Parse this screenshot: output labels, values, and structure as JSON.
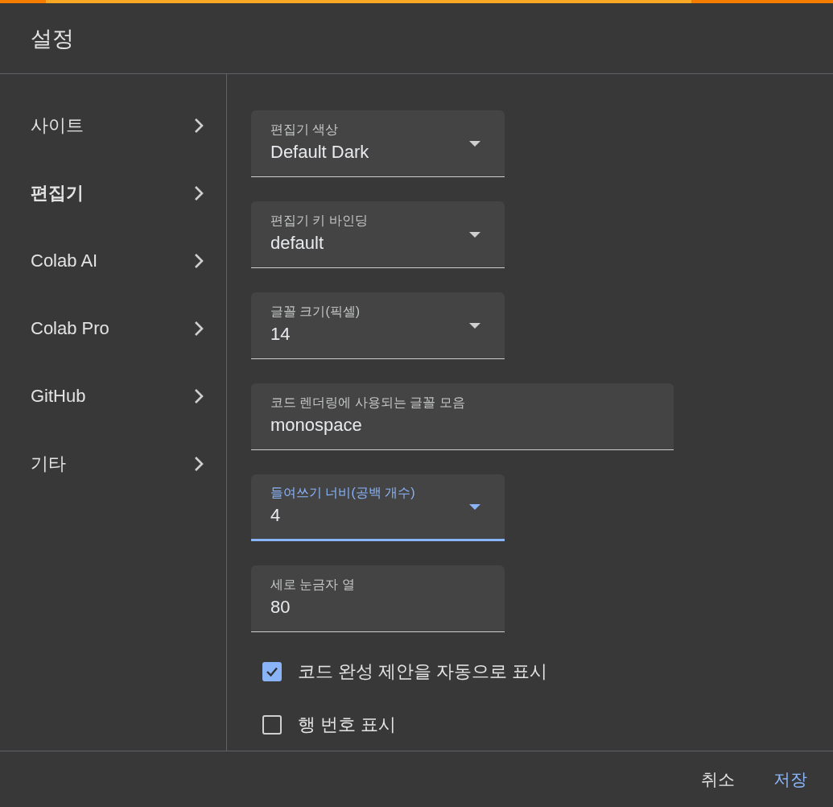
{
  "dialog": {
    "title": "설정"
  },
  "sidebar": {
    "items": [
      {
        "label": "사이트",
        "selected": false
      },
      {
        "label": "편집기",
        "selected": true
      },
      {
        "label": "Colab AI",
        "selected": false
      },
      {
        "label": "Colab Pro",
        "selected": false
      },
      {
        "label": "GitHub",
        "selected": false
      },
      {
        "label": "기타",
        "selected": false
      }
    ]
  },
  "settings": [
    {
      "kind": "select",
      "label": "편집기 색상",
      "value": "Default Dark",
      "focused": false
    },
    {
      "kind": "select",
      "label": "편집기 키 바인딩",
      "value": "default",
      "focused": false
    },
    {
      "kind": "select",
      "label": "글꼴 크기(픽셀)",
      "value": "14",
      "focused": false
    },
    {
      "kind": "longtext",
      "label": "코드 렌더링에 사용되는 글꼴 모음",
      "value": "monospace",
      "focused": false
    },
    {
      "kind": "select",
      "label": "들여쓰기 너비(공백 개수)",
      "value": "4",
      "focused": true
    },
    {
      "kind": "text",
      "label": "세로 눈금자 열",
      "value": "80",
      "focused": false
    },
    {
      "kind": "checkbox",
      "label": "코드 완성 제안을 자동으로 표시",
      "checked": true
    },
    {
      "kind": "checkbox",
      "label": "행 번호 표시",
      "checked": false
    }
  ],
  "buttons": [
    {
      "label": "취소",
      "primary": false
    },
    {
      "label": "저장",
      "primary": true
    }
  ]
}
